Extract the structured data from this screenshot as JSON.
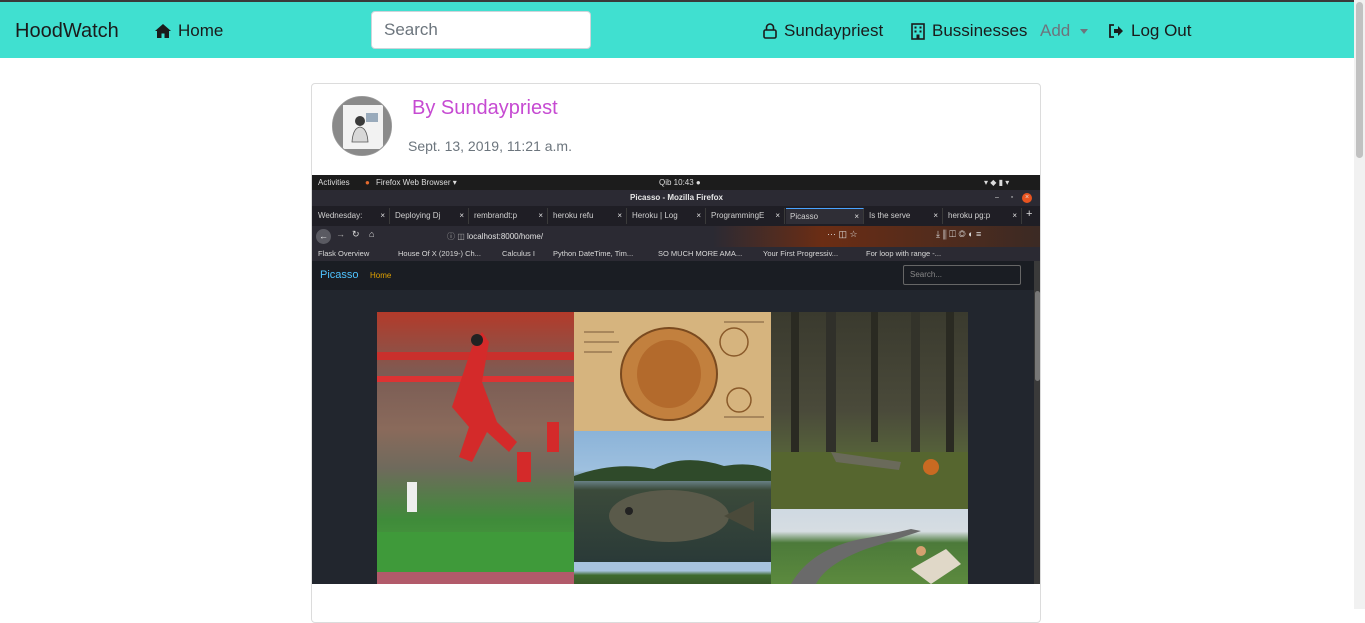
{
  "navbar": {
    "brand": "HoodWatch",
    "home": "Home",
    "search_placeholder": "Search",
    "user": "Sundaypriest",
    "businesses": "Bussinesses",
    "add": "Add",
    "logout": "Log Out",
    "bg_color": "#40e0d0"
  },
  "post": {
    "author": "By Sundaypriest",
    "date": "Sept. 13, 2019, 11:21 a.m.",
    "author_color": "#c64ad2"
  },
  "embedded_screenshot": {
    "system_bar": {
      "activities": "Activities",
      "app": "Firefox Web Browser ▾",
      "clock": "Qib 10:43 ●"
    },
    "window_title": "Picasso - Mozilla Firefox",
    "tabs": [
      "Wednesday:",
      "Deploying Dj",
      "rembrandt:p",
      "heroku refu",
      "Heroku | Log",
      "ProgrammingE",
      "Picasso",
      "Is the serve",
      "heroku pg:p"
    ],
    "active_tab": 6,
    "url": "localhost:8000/home/",
    "bookmarks": [
      "Flask Overview",
      "House Of X (2019-) Ch...",
      "Calculus I",
      "Python DateTime, Tim...",
      "SO MUCH MORE AMA...",
      "Your First Progressiv...",
      "For loop with range -..."
    ],
    "site": {
      "brand": "Picasso",
      "home": "Home",
      "search_placeholder": "Search..."
    }
  },
  "icons": {
    "home": "home-icon",
    "user": "user-icon",
    "businesses": "building-icon",
    "logout": "sign-out-icon"
  }
}
